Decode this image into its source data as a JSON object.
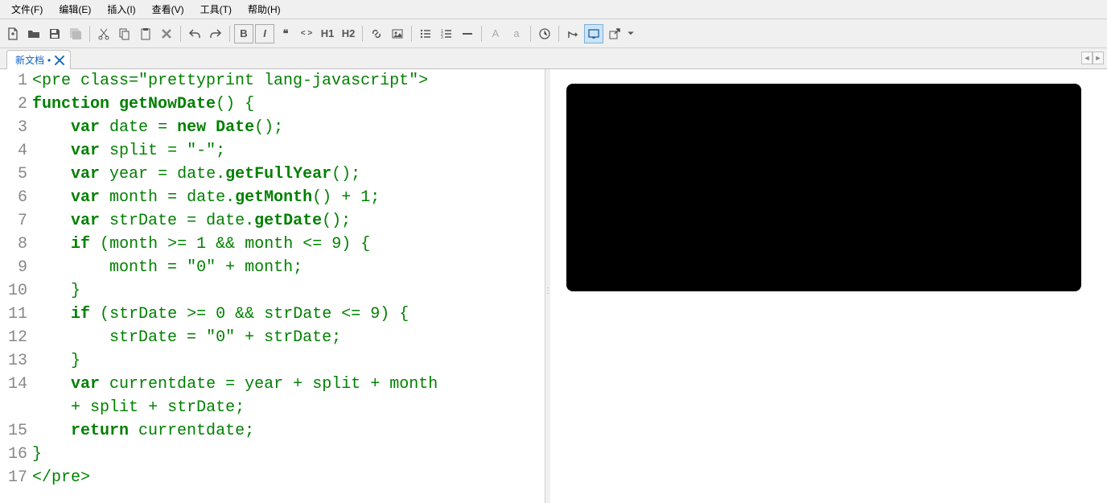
{
  "menus": {
    "file": "文件(F)",
    "edit": "编辑(E)",
    "insert": "插入(I)",
    "view": "查看(V)",
    "tools": "工具(T)",
    "help": "帮助(H)"
  },
  "tab": {
    "title": "新文档",
    "modified": "•"
  },
  "toolbar_txt": {
    "bold": "B",
    "italic": "I",
    "quote": "❝",
    "code": "< >",
    "h1": "H1",
    "h2": "H2",
    "upperA": "A",
    "lowerA": "a"
  },
  "code_lines": [
    {
      "n": "1",
      "html": "<span class='t'>&lt;pre class=\"prettyprint lang-javascript\"&gt;</span>"
    },
    {
      "n": "2",
      "html": "<span class='k'>function</span> <span class='f'>getNowDate</span><span class='p'>()</span> <span class='p'>{</span>"
    },
    {
      "n": "3",
      "html": "    <span class='k'>var</span> <span class='v'>date</span> <span class='p'>=</span> <span class='k'>new</span> <span class='f'>Date</span><span class='p'>();</span>"
    },
    {
      "n": "4",
      "html": "    <span class='k'>var</span> <span class='v'>split</span> <span class='p'>=</span> <span class='s'>\"-\"</span><span class='p'>;</span>"
    },
    {
      "n": "5",
      "html": "    <span class='k'>var</span> <span class='v'>year</span> <span class='p'>=</span> <span class='v'>date</span><span class='p'>.</span><span class='f'>getFullYear</span><span class='p'>();</span>"
    },
    {
      "n": "6",
      "html": "    <span class='k'>var</span> <span class='v'>month</span> <span class='p'>=</span> <span class='v'>date</span><span class='p'>.</span><span class='f'>getMonth</span><span class='p'>()</span> <span class='p'>+</span> <span class='n'>1</span><span class='p'>;</span>"
    },
    {
      "n": "7",
      "html": "    <span class='k'>var</span> <span class='v'>strDate</span> <span class='p'>=</span> <span class='v'>date</span><span class='p'>.</span><span class='f'>getDate</span><span class='p'>();</span>"
    },
    {
      "n": "8",
      "html": "    <span class='k'>if</span> <span class='p'>(</span><span class='v'>month</span> <span class='p'>&gt;=</span> <span class='n'>1</span> <span class='p'>&amp;&amp;</span> <span class='v'>month</span> <span class='p'>&lt;=</span> <span class='n'>9</span><span class='p'>)</span> <span class='p'>{</span>"
    },
    {
      "n": "9",
      "html": "        <span class='v'>month</span> <span class='p'>=</span> <span class='s'>\"0\"</span> <span class='p'>+</span> <span class='v'>month</span><span class='p'>;</span>"
    },
    {
      "n": "10",
      "html": "    <span class='p'>}</span>"
    },
    {
      "n": "11",
      "html": "    <span class='k'>if</span> <span class='p'>(</span><span class='v'>strDate</span> <span class='p'>&gt;=</span> <span class='n'>0</span> <span class='p'>&amp;&amp;</span> <span class='v'>strDate</span> <span class='p'>&lt;=</span> <span class='n'>9</span><span class='p'>)</span> <span class='p'>{</span>"
    },
    {
      "n": "12",
      "html": "        <span class='v'>strDate</span> <span class='p'>=</span> <span class='s'>\"0\"</span> <span class='p'>+</span> <span class='v'>strDate</span><span class='p'>;</span>"
    },
    {
      "n": "13",
      "html": "    <span class='p'>}</span>"
    },
    {
      "n": "14",
      "html": "    <span class='k'>var</span> <span class='v'>currentdate</span> <span class='p'>=</span> <span class='v'>year</span> <span class='p'>+</span> <span class='v'>split</span> <span class='p'>+</span> <span class='v'>month</span> "
    },
    {
      "n": "",
      "html": "    <span class='p'>+</span> <span class='v'>split</span> <span class='p'>+</span> <span class='v'>strDate</span><span class='p'>;</span>"
    },
    {
      "n": "15",
      "html": "    <span class='k'>return</span> <span class='v'>currentdate</span><span class='p'>;</span>"
    },
    {
      "n": "16",
      "html": "<span class='p'>}</span>"
    },
    {
      "n": "17",
      "html": "<span class='t'>&lt;/pre&gt;</span>"
    }
  ]
}
